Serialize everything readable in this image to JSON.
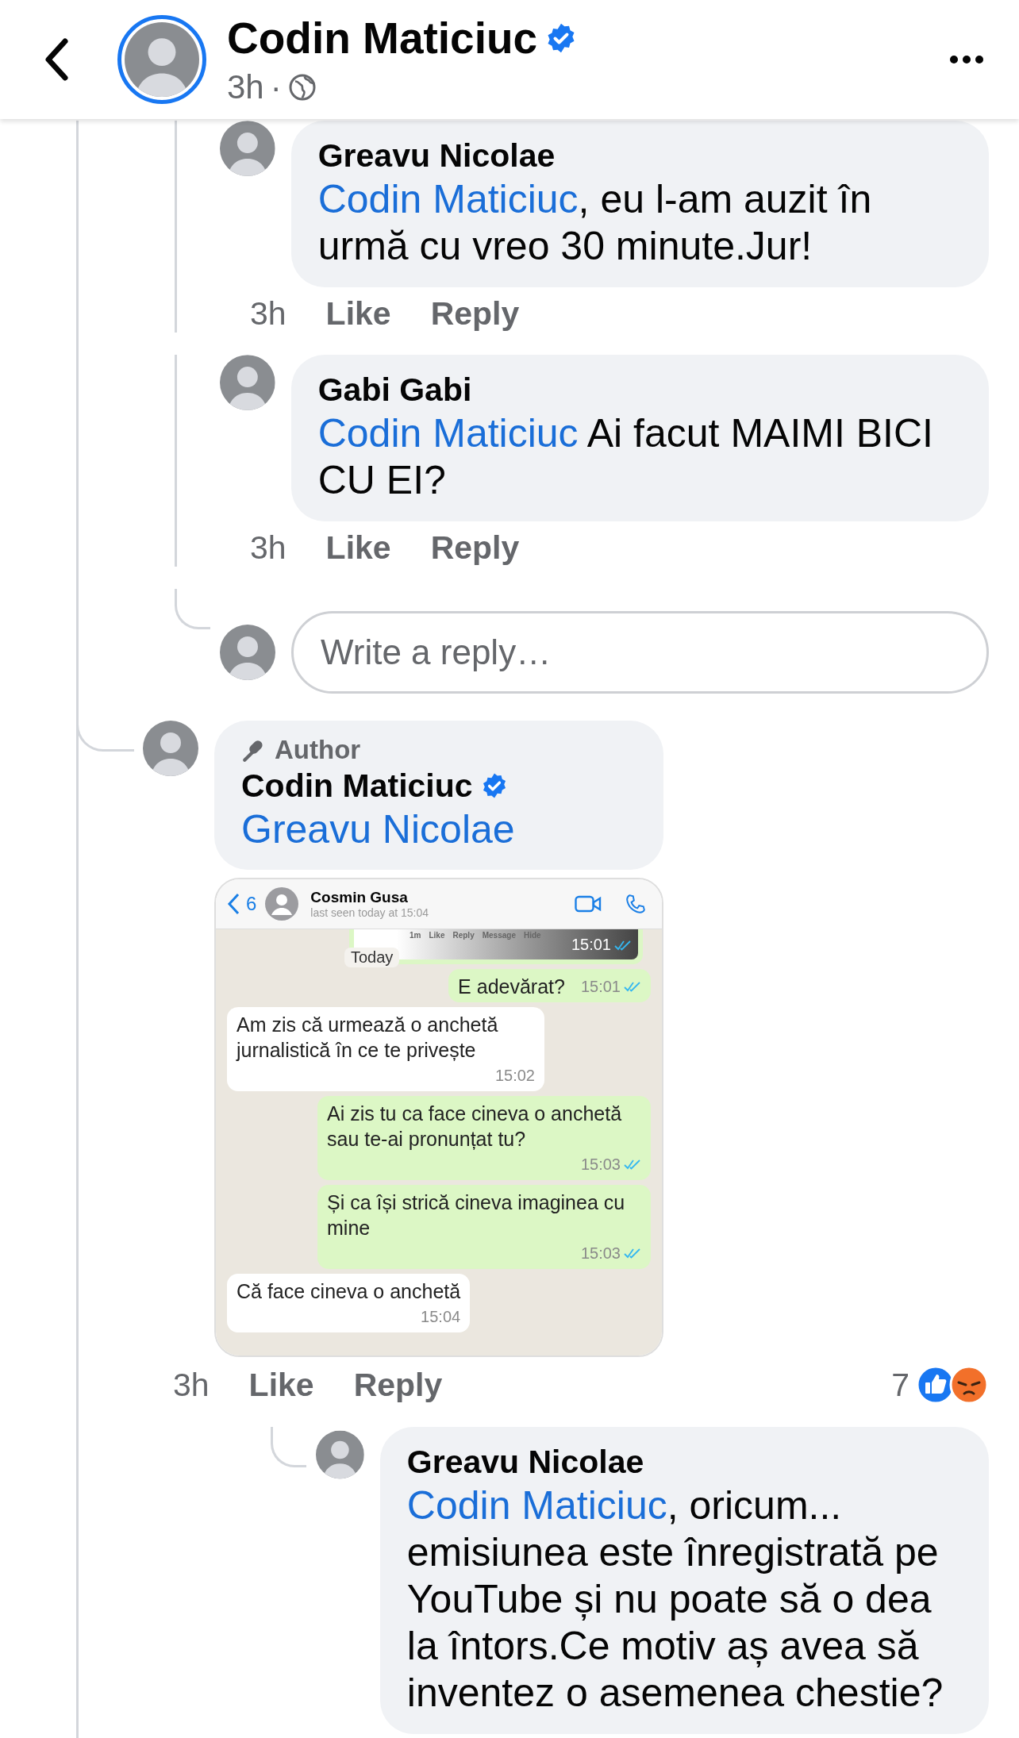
{
  "header": {
    "name": "Codin Maticiuc",
    "verified": true,
    "time": "3h",
    "separator": "·",
    "story_ring": true
  },
  "thread": [
    {
      "kind": "continued",
      "children": [
        {
          "kind": "comment",
          "author": "Greavu Nicolae",
          "mention": "Codin Maticiuc",
          "text": ", eu l-am auzit în urmă cu vreo 30 minute.Jur!",
          "time": "3h",
          "actions": [
            "Like",
            "Reply"
          ]
        },
        {
          "kind": "comment",
          "author": "Gabi Gabi",
          "mention": "Codin Maticiuc",
          "text": " Ai facut MAIMI BICI CU EI?",
          "time": "3h",
          "actions": [
            "Like",
            "Reply"
          ]
        },
        {
          "kind": "reply_box",
          "placeholder": "Write a reply…"
        }
      ]
    },
    {
      "kind": "comment",
      "badge": "Author",
      "author": "Codin Maticiuc",
      "verified": true,
      "mention": "Greavu Nicolae",
      "attachment": {
        "kind": "chat_screenshot",
        "back_count": "6",
        "contact": "Cosmin Gusa",
        "last_seen": "last seen today at 15:04",
        "quoted": {
          "items": [
            "1m",
            "Like",
            "Reply",
            "Message",
            "Hide"
          ],
          "time": "15:01"
        },
        "date_pill": "Today",
        "messages": [
          {
            "kind": "out",
            "text": "E adevărat?",
            "time": "15:01",
            "read": true
          },
          {
            "kind": "in",
            "text": "Am zis că urmează o anchetă jurnalistică în ce te privește",
            "time": "15:02",
            "read": false
          },
          {
            "kind": "out",
            "text": "Ai zis tu ca face cineva o anchetă sau te-ai pronunțat tu?",
            "time": "15:03",
            "read": true
          },
          {
            "kind": "out",
            "text": "Și ca își strică cineva imaginea cu mine",
            "time": "15:03",
            "read": true
          },
          {
            "kind": "in",
            "text": "Că face cineva o anchetă",
            "time": "15:04",
            "read": false
          }
        ]
      },
      "time": "3h",
      "actions": [
        "Like",
        "Reply"
      ],
      "reactions": {
        "count": "7",
        "items": [
          {
            "kind": "like"
          },
          {
            "kind": "angry"
          }
        ]
      },
      "children": [
        {
          "kind": "comment",
          "author": "Greavu Nicolae",
          "mention": "Codin Maticiuc",
          "text": ", oricum... emisiunea este înregistrată pe YouTube și nu poate să o dea la întors.Ce motiv aș avea să inventez o asemenea chestie?"
        }
      ]
    }
  ]
}
